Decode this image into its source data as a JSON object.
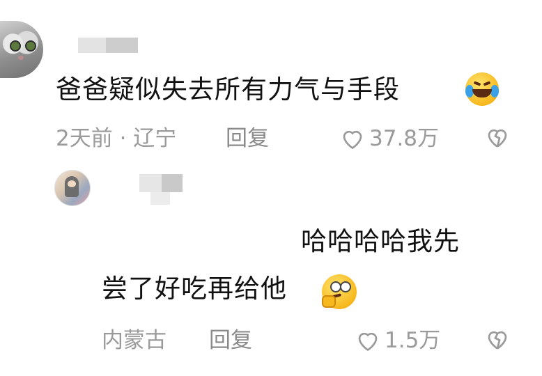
{
  "comments": [
    {
      "text": "爸爸疑似失去所有力气与手段",
      "meta": "2天前 · 辽宁",
      "reply_label": "回复",
      "likes": "37.8万",
      "emoji_icon": "rolling-laughing-emoji"
    },
    {
      "text_line1": "哈哈哈哈我先",
      "text_line2": "尝了好吃再给他",
      "meta": "内蒙古",
      "reply_label": "回复",
      "likes": "1.5万",
      "emoji_icon": "woozy-thinking-emoji"
    }
  ],
  "colors": {
    "text": "#111111",
    "meta": "#9a9a9a",
    "background": "#ffffff"
  }
}
